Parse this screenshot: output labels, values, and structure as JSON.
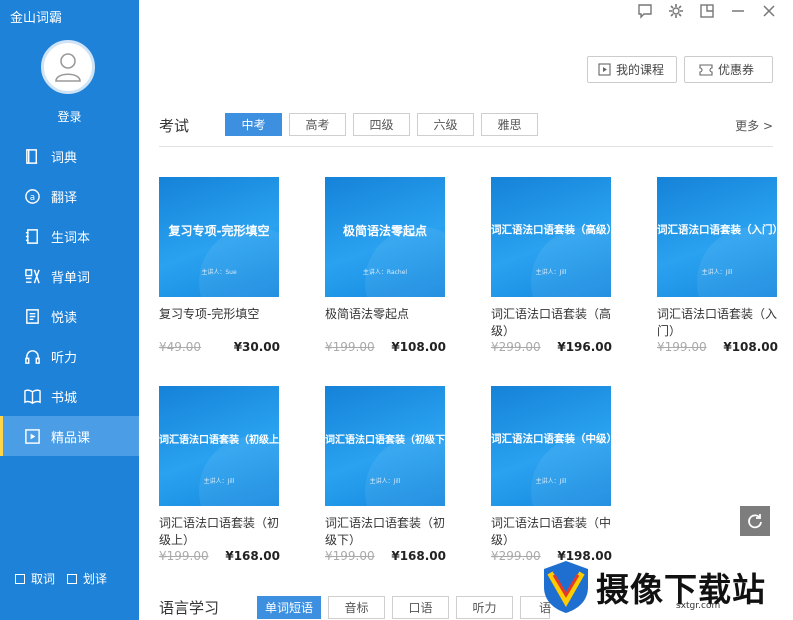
{
  "app": {
    "title": "金山词霸"
  },
  "user": {
    "login_label": "登录"
  },
  "sidebar": {
    "items": [
      {
        "label": "词典",
        "icon": "book-icon"
      },
      {
        "label": "翻译",
        "icon": "translate-icon"
      },
      {
        "label": "生词本",
        "icon": "notebook-icon"
      },
      {
        "label": "背单词",
        "icon": "recite-icon"
      },
      {
        "label": "悦读",
        "icon": "reading-icon"
      },
      {
        "label": "听力",
        "icon": "headphones-icon"
      },
      {
        "label": "书城",
        "icon": "open-book-icon"
      },
      {
        "label": "精品课",
        "icon": "play-icon",
        "active": true
      }
    ],
    "options": [
      {
        "label": "取词"
      },
      {
        "label": "划译"
      }
    ]
  },
  "header": {
    "my_courses_label": "我的课程",
    "coupons_label": "优惠券"
  },
  "exam": {
    "title": "考试",
    "tabs": [
      {
        "label": "中考",
        "active": true
      },
      {
        "label": "高考"
      },
      {
        "label": "四级"
      },
      {
        "label": "六级"
      },
      {
        "label": "雅思"
      }
    ],
    "more_label": "更多 >",
    "courses": [
      {
        "thumb_title": "复习专项-完形填空",
        "thumb_sub": "主讲人：Sue",
        "name": "复习专项-完形填空",
        "old_price": "¥49.00",
        "price": "¥30.00"
      },
      {
        "thumb_title": "极简语法零起点",
        "thumb_sub": "主讲人：Rachel",
        "name": "极简语法零起点",
        "old_price": "¥199.00",
        "price": "¥108.00"
      },
      {
        "thumb_title": "词汇语法口语套装（高级）",
        "thumb_sub": "主讲人：Jill",
        "name": "词汇语法口语套装（高级）",
        "old_price": "¥299.00",
        "price": "¥196.00"
      },
      {
        "thumb_title": "词汇语法口语套装（入门）",
        "thumb_sub": "主讲人：Jill",
        "name": "词汇语法口语套装（入门）",
        "old_price": "¥199.00",
        "price": "¥108.00"
      },
      {
        "thumb_title": "词汇语法口语套装（初级上）",
        "thumb_sub": "主讲人：Jill",
        "name": "词汇语法口语套装（初级上）",
        "old_price": "¥199.00",
        "price": "¥168.00"
      },
      {
        "thumb_title": "词汇语法口语套装（初级下）",
        "thumb_sub": "主讲人：Jill",
        "name": "词汇语法口语套装（初级下）",
        "old_price": "¥199.00",
        "price": "¥168.00"
      },
      {
        "thumb_title": "词汇语法口语套装（中级）",
        "thumb_sub": "主讲人：Jill",
        "name": "词汇语法口语套装（中级）",
        "old_price": "¥299.00",
        "price": "¥198.00"
      }
    ]
  },
  "language": {
    "title": "语言学习",
    "tabs": [
      {
        "label": "单词短语",
        "active": true
      },
      {
        "label": "音标"
      },
      {
        "label": "口语"
      },
      {
        "label": "听力"
      },
      {
        "label": "语"
      }
    ]
  },
  "watermark": {
    "text": "摄像下载站",
    "url": "sxtgr.com"
  },
  "colors": {
    "sidebar": "#1e82d9",
    "accent": "#3d8fe0",
    "thumb": "#1a8fe3"
  }
}
